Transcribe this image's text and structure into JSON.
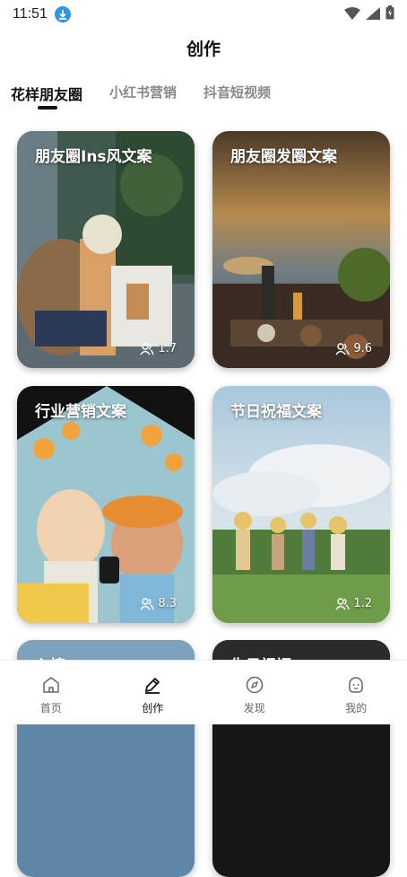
{
  "status_bar": {
    "time": "11:51"
  },
  "header": {
    "title": "创作"
  },
  "tabs": [
    {
      "label": "花样朋友圈",
      "active": true
    },
    {
      "label": "小红书营销",
      "active": false
    },
    {
      "label": "抖音短视频",
      "active": false
    }
  ],
  "cards": [
    {
      "title": "朋友圈Ins风文案",
      "count": "1.7"
    },
    {
      "title": "朋友圈发圈文案",
      "count": "9.6"
    },
    {
      "title": "行业营销文案",
      "count": "8.3"
    },
    {
      "title": "节日祝福文案",
      "count": "1.2"
    },
    {
      "title": "心情",
      "count": ""
    },
    {
      "title": "生日祝福",
      "count": ""
    }
  ],
  "bottom_nav": [
    {
      "label": "首页",
      "icon": "home-icon"
    },
    {
      "label": "创作",
      "icon": "pen-icon"
    },
    {
      "label": "发现",
      "icon": "compass-icon"
    },
    {
      "label": "我的",
      "icon": "face-icon"
    }
  ],
  "colors": {
    "download_badge": "#2c95e8",
    "text_primary": "#111111",
    "tab_inactive": "#888888"
  }
}
